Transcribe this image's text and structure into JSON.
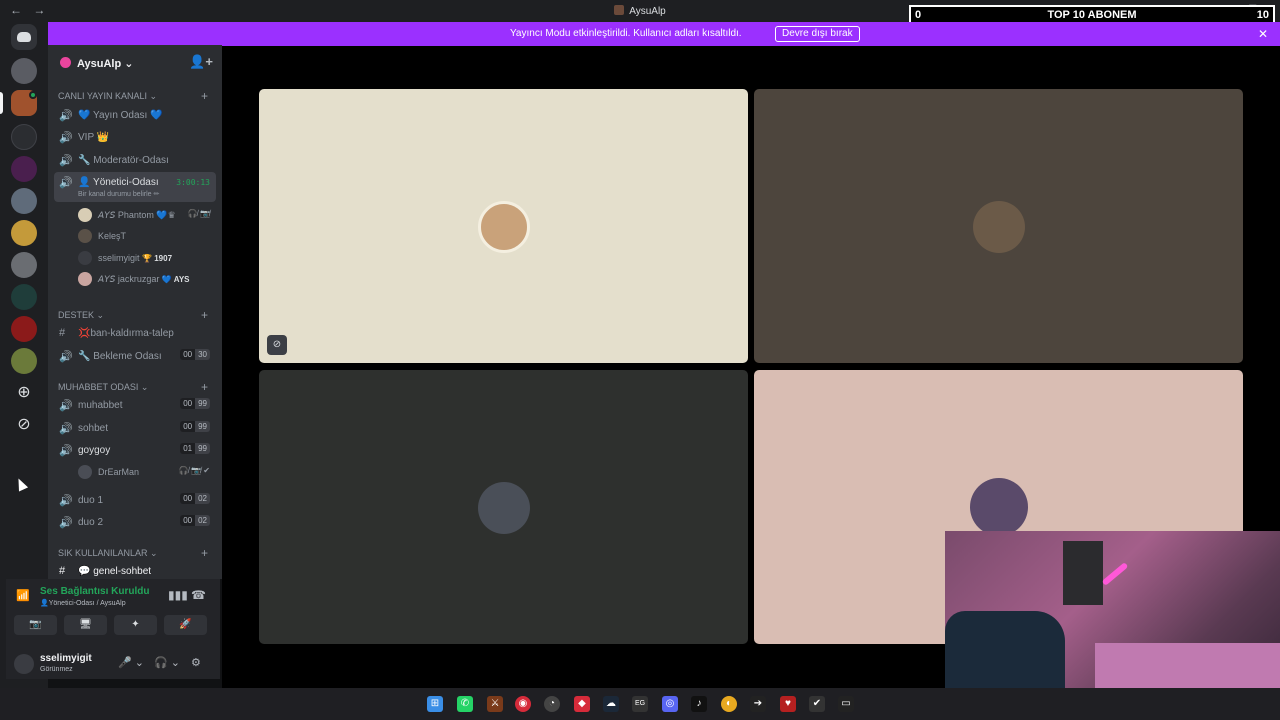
{
  "window": {
    "nav_back": "←",
    "nav_forward": "→",
    "title": "AysuAlp",
    "controls": [
      "⊟",
      "?",
      "—",
      "☐",
      "✕"
    ]
  },
  "subscriber_overlay": {
    "left": "0",
    "center": "TOP 10 ABONEM",
    "right": "10"
  },
  "banner": {
    "text": "Yayıncı Modu etkinleştirildi. Kullanıcı adları kısaltıldı.",
    "button": "Devre dışı bırak",
    "close": "✕"
  },
  "guild": {
    "name": "AysuAlp ⌄",
    "invite_icon": "👤+"
  },
  "categories": {
    "live": "CANLI YAYIN KANALI ⌄",
    "support": "DESTEK ⌄",
    "chat": "MUHABBET ODASI ⌄",
    "frequent": "SIK KULLANILANLAR ⌄"
  },
  "channels": {
    "yayin": "💙 Yayın Odası 💙",
    "vip": "VIP 👑",
    "moderator": "🔧 Moderatör-Odası",
    "yonetici": "👤 Yönetici-Odası",
    "yonetici_sub": "Bir kanal durumu belirle ✏",
    "yonetici_time": "3:00:13",
    "ban": "💢ban-kaldırma-talep",
    "bekleme": "🔧 Bekleme Odası",
    "bekleme_a": "00",
    "bekleme_b": "30",
    "muhabbet": "muhabbet",
    "muhabbet_a": "00",
    "muhabbet_b": "99",
    "sohbet": "sohbet",
    "sohbet_a": "00",
    "sohbet_b": "99",
    "goygoy": "goygoy",
    "goygoy_a": "01",
    "goygoy_b": "99",
    "duo1": "duo 1",
    "duo1_a": "00",
    "duo1_b": "02",
    "duo2": "duo 2",
    "duo2_a": "00",
    "duo2_b": "02",
    "genel": "💬 genel-sohbet"
  },
  "voice_users": {
    "u1": "𝘈𝘠𝘚 Phantom",
    "u1_extra": "💙♛",
    "u1_icons": "🎧̸ 📷̸",
    "u2": "KeleşT",
    "u3": "sselimyigit",
    "u3_extra": "🏆 1907",
    "u4": "𝘈𝘠𝘚 jackruzgar",
    "u4_extra": "💙 AYS",
    "u5": "DrEarMan",
    "u5_icons": "🎧̸ 📷̸ ✔"
  },
  "connection": {
    "status": "Ses Bağlantısı Kuruldu",
    "channel": "👤Yönetici-Odası / AysuAlp",
    "signal_icon": "📶",
    "bars_icon": "▮▮▮",
    "hangup_icon": "☎"
  },
  "action_buttons": [
    "📷",
    "🖥",
    "✦",
    "🚀"
  ],
  "user": {
    "name": "sselimyigit",
    "status": "Görünmez",
    "mic": "🎤 ⌄",
    "headset": "🎧 ⌄",
    "settings": "⚙"
  },
  "tiles": {
    "pill_icon": "⊘"
  },
  "taskbar_icons": [
    "⊞",
    "✆",
    "⚔",
    "◉",
    "◔",
    "◆",
    "☁",
    "EG",
    "◎",
    "♪",
    "◐",
    "➔",
    "♥",
    "✔",
    "▭"
  ]
}
